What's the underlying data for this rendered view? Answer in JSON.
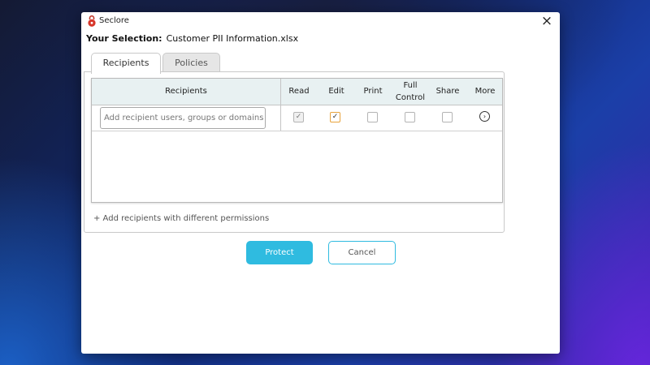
{
  "app": {
    "title": "Seclore"
  },
  "selection": {
    "label": "Your Selection:",
    "file": "Customer PII Information.xlsx"
  },
  "tabs": [
    {
      "label": "Recipients",
      "active": true
    },
    {
      "label": "Policies",
      "active": false
    }
  ],
  "table": {
    "headers": {
      "recipients": "Recipients",
      "read": "Read",
      "edit": "Edit",
      "print": "Print",
      "full_control_1": "Full",
      "full_control_2": "Control",
      "share": "Share",
      "more": "More"
    },
    "input_placeholder": "Add recipient users, groups or domains",
    "permissions": {
      "read": true,
      "edit": true,
      "print": false,
      "full_control": false,
      "share": false
    }
  },
  "add_link": "+ Add recipients with different permissions",
  "buttons": {
    "protect": "Protect",
    "cancel": "Cancel"
  },
  "icons": {
    "app": "seclore-lock-icon",
    "close": "close-icon",
    "more": "chevron-right-circle-icon",
    "check": "checkmark-icon"
  },
  "colors": {
    "accent": "#2fbbe0",
    "edit_checkbox": "#e8a33c",
    "header_bg": "#e8f1f2"
  }
}
